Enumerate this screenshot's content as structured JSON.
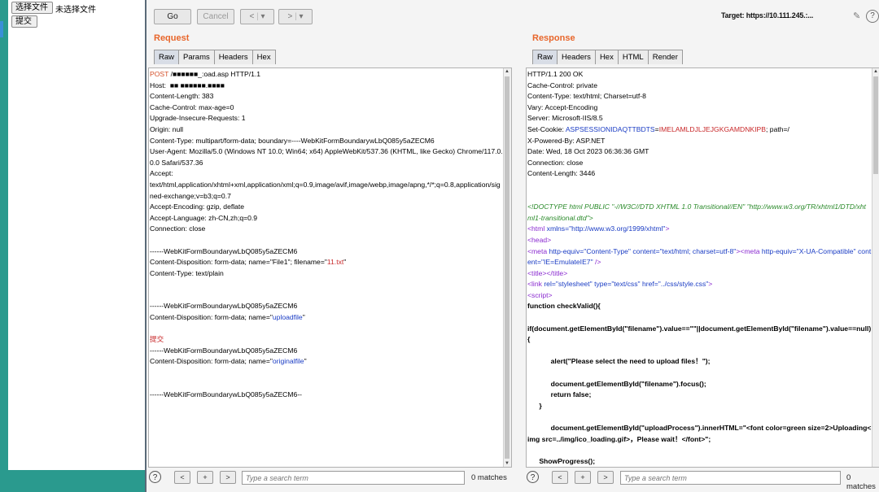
{
  "left_page": {
    "choose_file_button": "选择文件",
    "no_file_text": "未选择文件",
    "submit_button": "提交"
  },
  "toolbar": {
    "go": "Go",
    "cancel": "Cancel",
    "back": "<",
    "back_menu": "▾",
    "forward": ">",
    "forward_menu": "▾",
    "target": "Target: https://10.111.245.:...",
    "help": "?"
  },
  "request": {
    "title": "Request",
    "tabs": [
      "Raw",
      "Params",
      "Headers",
      "Hex"
    ],
    "lines": [
      [
        {
          "t": "POST ",
          "c": "val-orange"
        },
        {
          "t": "/■■■■■■_:oad.asp HTTP/1.1",
          "c": "key"
        }
      ],
      [
        {
          "t": "Host: ",
          "c": "key"
        },
        {
          "t": " ■■ ■■■■■■.■■■■",
          "c": "key"
        }
      ],
      [
        {
          "t": "Content-Length: 383",
          "c": "key"
        }
      ],
      [
        {
          "t": "Cache-Control: max-age=0",
          "c": "key"
        }
      ],
      [
        {
          "t": "Upgrade-Insecure-Requests: 1",
          "c": "key"
        }
      ],
      [
        {
          "t": "Origin: null",
          "c": "key"
        }
      ],
      [
        {
          "t": "Content-Type: multipart/form-data; boundary=----WebKitFormBoundarywLbQ085y5aZECM6",
          "c": "key"
        }
      ],
      [
        {
          "t": "User-Agent: Mozilla/5.0 (Windows NT 10.0; Win64; x64) AppleWebKit/537.36 (KHTML, like Gecko) Chrome/117.0.0.0 Safari/537.36",
          "c": "key"
        }
      ],
      [
        {
          "t": "Accept:",
          "c": "key"
        }
      ],
      [
        {
          "t": "text/html,application/xhtml+xml,application/xml;q=0.9,image/avif,image/webp,image/apng,*/*;q=0.8,application/signed-exchange;v=b3;q=0.7",
          "c": "key"
        }
      ],
      [
        {
          "t": "Accept-Encoding: gzip, deflate",
          "c": "key"
        }
      ],
      [
        {
          "t": "Accept-Language: zh-CN,zh;q=0.9",
          "c": "key"
        }
      ],
      [
        {
          "t": "Connection: close",
          "c": "key"
        }
      ],
      [],
      [
        {
          "t": "------WebKitFormBoundarywLbQ085y5aZECM6",
          "c": "key"
        }
      ],
      [
        {
          "t": "Content-Disposition: form-data; name=\"File1\"; filename=\"",
          "c": "key"
        },
        {
          "t": "11.txt",
          "c": "val-red"
        },
        {
          "t": "\"",
          "c": "key"
        }
      ],
      [
        {
          "t": "Content-Type: text/plain",
          "c": "key"
        }
      ],
      [],
      [],
      [
        {
          "t": "------WebKitFormBoundarywLbQ085y5aZECM6",
          "c": "key"
        }
      ],
      [
        {
          "t": "Content-Disposition: form-data; name=\"",
          "c": "key"
        },
        {
          "t": "uploadfile",
          "c": "val-blue"
        },
        {
          "t": "\"",
          "c": "key"
        }
      ],
      [],
      [
        {
          "t": "提交",
          "c": "val-red"
        }
      ],
      [
        {
          "t": "------WebKitFormBoundarywLbQ085y5aZECM6",
          "c": "key"
        }
      ],
      [
        {
          "t": "Content-Disposition: form-data; name=\"",
          "c": "key"
        },
        {
          "t": "originalfile",
          "c": "val-blue"
        },
        {
          "t": "\"",
          "c": "key"
        }
      ],
      [],
      [],
      [
        {
          "t": "------WebKitFormBoundarywLbQ085y5aZECM6--",
          "c": "key"
        }
      ]
    ],
    "search_placeholder": "Type a search term",
    "matches": "0 matches"
  },
  "response": {
    "title": "Response",
    "tabs": [
      "Raw",
      "Headers",
      "Hex",
      "HTML",
      "Render"
    ],
    "lines": [
      [
        {
          "t": "HTTP/1.1 200 OK",
          "c": "key"
        }
      ],
      [
        {
          "t": "Cache-Control: private",
          "c": "key"
        }
      ],
      [
        {
          "t": "Content-Type: text/html; Charset=utf-8",
          "c": "key"
        }
      ],
      [
        {
          "t": "Vary: Accept-Encoding",
          "c": "key"
        }
      ],
      [
        {
          "t": "Server: Microsoft-IIS/8.5",
          "c": "key"
        }
      ],
      [
        {
          "t": "Set-Cookie: ",
          "c": "key"
        },
        {
          "t": "ASPSESSIONIDAQTTBDTS",
          "c": "val-blue"
        },
        {
          "t": "=",
          "c": "key"
        },
        {
          "t": "IMELAMLDJLJEJGKGAMDNKIPB",
          "c": "val-red"
        },
        {
          "t": "; path=/",
          "c": "key"
        }
      ],
      [
        {
          "t": "X-Powered-By: ASP.NET",
          "c": "key"
        }
      ],
      [
        {
          "t": "Date: Wed, 18 Oct 2023 06:36:36 GMT",
          "c": "key"
        }
      ],
      [
        {
          "t": "Connection: close",
          "c": "key"
        }
      ],
      [
        {
          "t": "Content-Length: 3446",
          "c": "key"
        }
      ],
      [],
      [],
      [
        {
          "t": "<!DOCTYPE html PUBLIC \"-//W3C//DTD XHTML 1.0 Transitional//EN\" \"http://www.w3.org/TR/xhtml1/DTD/xhtml1-transitional.dtd\">",
          "c": "comment"
        }
      ],
      [
        {
          "t": "<html ",
          "c": "tag"
        },
        {
          "t": "xmlns",
          "c": "attr"
        },
        {
          "t": "=\"http://www.w3.org/1999/xhtml\"",
          "c": "str"
        },
        {
          "t": ">",
          "c": "tag"
        }
      ],
      [
        {
          "t": "<head>",
          "c": "tag"
        }
      ],
      [
        {
          "t": "<meta ",
          "c": "tag"
        },
        {
          "t": "http-equiv",
          "c": "attr"
        },
        {
          "t": "=\"Content-Type\" ",
          "c": "str"
        },
        {
          "t": "content",
          "c": "attr"
        },
        {
          "t": "=\"text/html; charset=utf-8\"",
          "c": "str"
        },
        {
          "t": "><meta ",
          "c": "tag"
        },
        {
          "t": "http-equiv",
          "c": "attr"
        },
        {
          "t": "=\"X-UA-Compatible\" ",
          "c": "str"
        },
        {
          "t": "content",
          "c": "attr"
        },
        {
          "t": "=\"IE=EmulateIE7\"",
          "c": "str"
        },
        {
          "t": " />",
          "c": "tag"
        }
      ],
      [
        {
          "t": "<title></title>",
          "c": "tag"
        }
      ],
      [
        {
          "t": "<link ",
          "c": "tag"
        },
        {
          "t": "rel",
          "c": "attr"
        },
        {
          "t": "=\"stylesheet\" ",
          "c": "str"
        },
        {
          "t": "type",
          "c": "attr"
        },
        {
          "t": "=\"text/css\" ",
          "c": "str"
        },
        {
          "t": "href",
          "c": "attr"
        },
        {
          "t": "=\"../css/style.css\"",
          "c": "str"
        },
        {
          "t": ">",
          "c": "tag"
        }
      ],
      [
        {
          "t": "<script>",
          "c": "tag"
        }
      ],
      [
        {
          "t": "function checkValid(){",
          "c": "bold"
        }
      ],
      [],
      [
        {
          "t": "if(document.getElementById(\"filename\").value==\"\"||document.getElementById(\"filename\").value==null){",
          "c": "bold"
        }
      ],
      [],
      [
        {
          "t": "            alert(\"Please select the need to upload files！\");",
          "c": "bold"
        }
      ],
      [],
      [
        {
          "t": "            document.getElementById(\"filename\").focus();",
          "c": "bold"
        }
      ],
      [
        {
          "t": "            return false;",
          "c": "bold"
        }
      ],
      [
        {
          "t": "      }",
          "c": "bold"
        }
      ],
      [],
      [
        {
          "t": "            document.getElementById(\"uploadProcess\").innerHTML=\"<font color=green size=2>Uploading<img src=../img/ico_loading.gif>，Please wait！</font>\";",
          "c": "bold"
        }
      ],
      [],
      [
        {
          "t": "      ShowProgress();",
          "c": "bold"
        }
      ]
    ],
    "search_placeholder": "Type a search term",
    "matches": "0 matches"
  },
  "search_nav": {
    "prev": "<",
    "add": "+",
    "next": ">",
    "help": "?"
  }
}
